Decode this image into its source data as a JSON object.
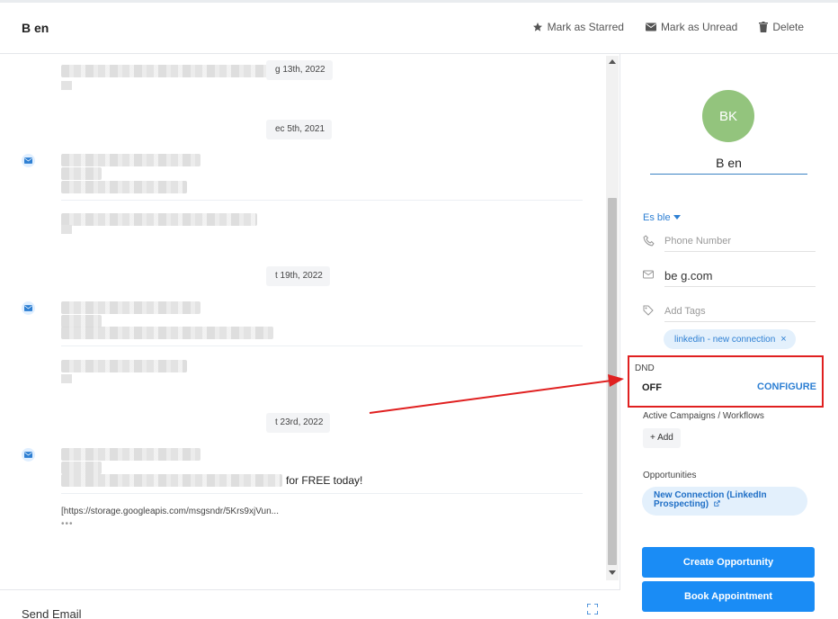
{
  "header": {
    "contact_name": "B        en",
    "actions": {
      "star": "Mark as Starred",
      "unread": "Mark as Unread",
      "delete": "Delete"
    }
  },
  "conversation": {
    "dates": [
      "g 13th, 2022",
      "ec 5th, 2021",
      "t 19th, 2022",
      "t 23rd, 2022"
    ],
    "last_message_tail": "for FREE today!",
    "link": "[https://storage.googleapis.com/msgsndr/5Krs9xjVun...",
    "more": "•••"
  },
  "footer": {
    "send_email": "Send Email"
  },
  "contact": {
    "initials": "BK",
    "name": "B        en",
    "owner": "Es           ble",
    "phone_placeholder": "Phone Number",
    "email": "be                              g.com",
    "tags_placeholder": "Add Tags",
    "tag": "linkedin - new connection",
    "dnd_label": "DND",
    "dnd_status": "OFF",
    "configure": "CONFIGURE",
    "campaigns_label": "Active Campaigns / Workflows",
    "add_label": "Add",
    "opportunities_label": "Opportunities",
    "opportunity": "New Connection (LinkedIn Prospecting)",
    "create_opportunity": "Create Opportunity",
    "book_appointment": "Book Appointment"
  },
  "colors": {
    "accent": "#1a8cf5",
    "highlight_red": "#e02020",
    "avatar": "#93c47d"
  }
}
